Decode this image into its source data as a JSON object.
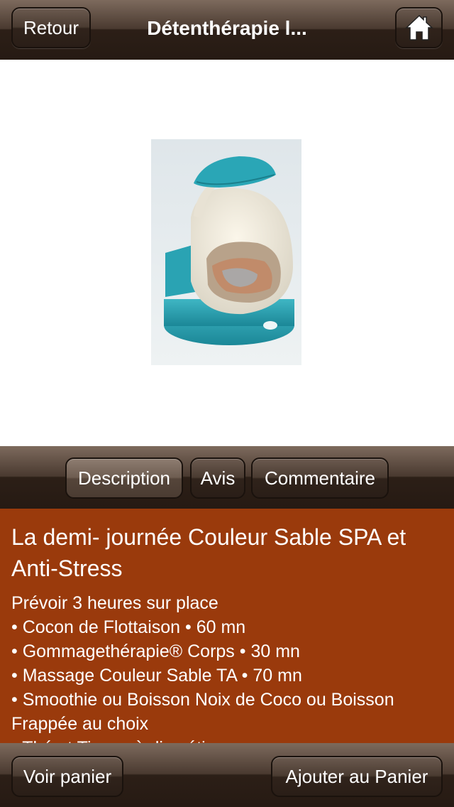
{
  "header": {
    "back_label": "Retour",
    "title": "Détenthérapie l...",
    "home_icon": "home-icon"
  },
  "image": {
    "description": "floatation-pod-photo"
  },
  "tabs": [
    {
      "label": "Description",
      "active": true
    },
    {
      "label": "Avis",
      "active": false
    },
    {
      "label": "Commentaire",
      "active": false
    }
  ],
  "content": {
    "title": "La demi- journée Couleur Sable SPA et Anti-Stress",
    "lines": [
      "Prévoir 3 heures sur place",
      "• Cocon de Flottaison • 60 mn",
      "• Gommagethérapie® Corps • 30 mn",
      "• Massage Couleur Sable TA • 70 mn",
      "• Smoothie ou Boisson Noix de Coco ou Boisson Frappée au choix",
      "• Thé et Tisane à discrétion"
    ]
  },
  "footer": {
    "cart_label": "Voir panier",
    "add_label": "Ajouter au Panier"
  },
  "colors": {
    "content_bg": "#9a3a0c",
    "bar_dark": "#2c1f17"
  }
}
